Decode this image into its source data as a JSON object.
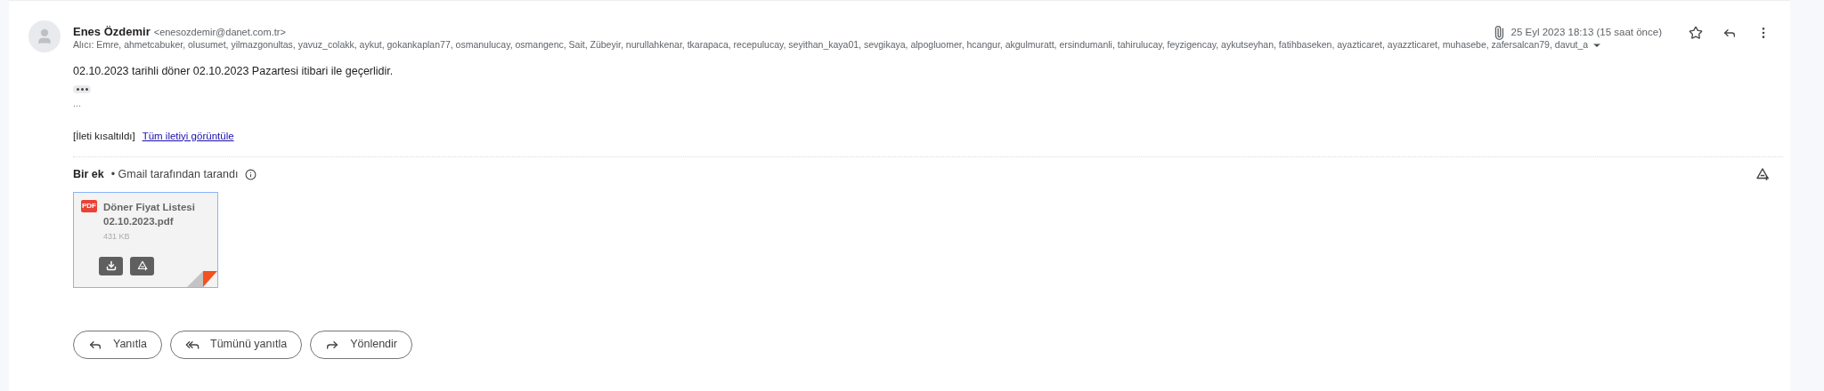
{
  "sender": {
    "name": "Enes Özdemir",
    "email": "<enesozdemir@danet.com.tr>"
  },
  "recipients": "Alıcı: Emre, ahmetcabuker, olusumet, yilmazgonultas, yavuz_colakk, aykut, gokankaplan77, osmanulucay, osmangenc, Sait, Zübeyir, nurullahkenar, tkarapaca, recepulucay, seyithan_kaya01, sevgikaya, alpogluomer, hcangur, akgulmuratt, ersindumanli, tahirulucay, feyzigencay, aykutseyhan, fatihbaseken, ayazticaret, ayazzticaret, muhasebe, zafersalcan79, davut_a",
  "date": "25 Eyl 2023 18:13 (15 saat önce)",
  "starred": false,
  "body": "02.10.2023 tarihli döner 02.10.2023 Pazartesi itibari ile geçerlidir.",
  "ellipsis": "...",
  "clipped_note": "[İleti kısaltıldı]",
  "clipped_link": "Tüm iletiyi görüntüle",
  "attachments_header": {
    "title": "Bir ek",
    "note": "• Gmail tarafından tarandı"
  },
  "attachments": [
    {
      "name": "Döner Fiyat Listesi 02.10.2023.pdf",
      "size": "431 KB",
      "badge": "PDF"
    }
  ],
  "actions": [
    {
      "kind": "reply",
      "label": "Yanıtla"
    },
    {
      "kind": "reply_all",
      "label": "Tümünü yanıtla"
    },
    {
      "kind": "forward",
      "label": "Yönlendir"
    }
  ]
}
